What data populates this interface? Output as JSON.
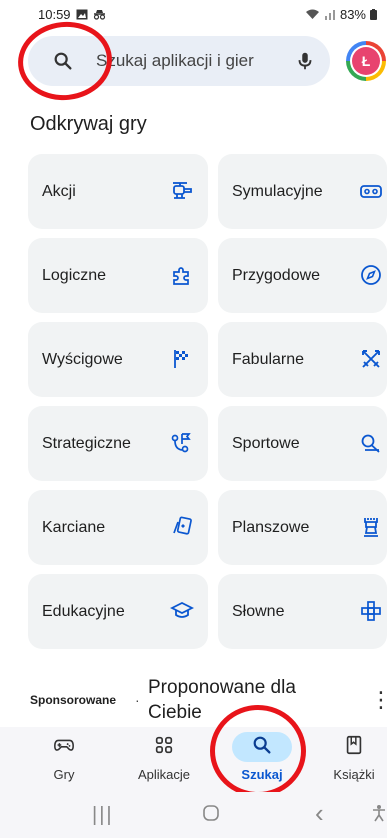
{
  "status_bar": {
    "time": "10:59",
    "battery": "83%",
    "icons": [
      "gallery-icon",
      "incognito-icon",
      "wifi-icon",
      "signal-icon",
      "battery-icon"
    ]
  },
  "search": {
    "placeholder": "Szukaj aplikacji i gier",
    "icons": [
      "search-icon",
      "mic-icon"
    ]
  },
  "avatar": {
    "letter": "Ł"
  },
  "section_title": "Odkrywaj gry",
  "categories": [
    {
      "label": "Akcji",
      "icon": "helicopter-icon"
    },
    {
      "label": "Symulacyjne",
      "icon": "vr-headset-icon"
    },
    {
      "label": "Logiczne",
      "icon": "puzzle-icon"
    },
    {
      "label": "Przygodowe",
      "icon": "compass-icon"
    },
    {
      "label": "Wyścigowe",
      "icon": "checkered-flag-icon"
    },
    {
      "label": "Fabularne",
      "icon": "crossed-swords-icon"
    },
    {
      "label": "Strategiczne",
      "icon": "strategy-icon"
    },
    {
      "label": "Sportowe",
      "icon": "whistle-icon"
    },
    {
      "label": "Karciane",
      "icon": "cards-icon"
    },
    {
      "label": "Planszowe",
      "icon": "chess-rook-icon"
    },
    {
      "label": "Edukacyjne",
      "icon": "graduation-cap-icon"
    },
    {
      "label": "Słowne",
      "icon": "word-grid-icon"
    }
  ],
  "sponsored": {
    "label": "Sponsorowane",
    "separator": "·",
    "title": "Proponowane dla Ciebie",
    "more": "⋮"
  },
  "bottom_nav": [
    {
      "label": "Gry",
      "icon": "gamepad-icon"
    },
    {
      "label": "Aplikacje",
      "icon": "apps-icon"
    },
    {
      "label": "Szukaj",
      "icon": "search-icon",
      "active": true
    },
    {
      "label": "Książki",
      "icon": "bookmark-book-icon"
    }
  ],
  "system_nav": {
    "recents": "|||",
    "back": "‹"
  },
  "colors": {
    "accent": "#0b57d0",
    "active_pill": "#c2e7ff",
    "tile_bg": "#f1f3f4",
    "annotation_circle": "#e8141a"
  }
}
